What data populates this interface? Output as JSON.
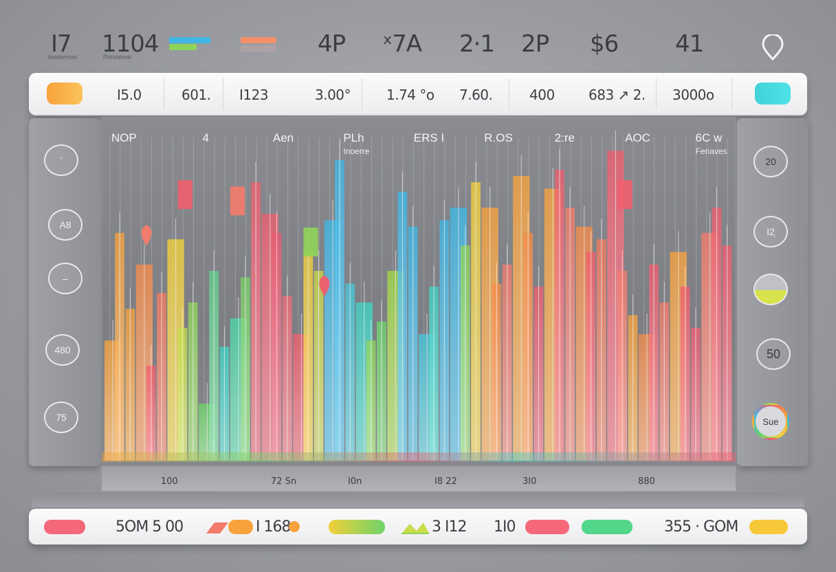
{
  "top_stats": [
    {
      "value": "I7",
      "sub": "Iooolvrnon"
    },
    {
      "value": "1104",
      "sub": "Porvomne"
    },
    {
      "value": "4P"
    },
    {
      "value": "ˣ7A"
    },
    {
      "value": "2·1"
    },
    {
      "value": "2P"
    },
    {
      "value": "$6"
    },
    {
      "value": "41"
    }
  ],
  "header_values": [
    "I5.0",
    "601.",
    "I123",
    "3.00°",
    "1.74 °o",
    "7.60.",
    "400",
    "683 ↗ 2.",
    "3000o"
  ],
  "left_controls": [
    "’",
    "A8",
    "–",
    "480",
    "75"
  ],
  "right_controls": [
    "20",
    "I2̩",
    "",
    "50",
    "Sue"
  ],
  "axis_labels": [
    "100",
    "72 Sn",
    "I0n",
    "I8 22",
    "3I0",
    "880"
  ],
  "bottom_values": [
    "5OM 5 00",
    "I 168",
    "3 I12",
    "1I0",
    "355 · GOM"
  ],
  "colors": {
    "red": "#ef5e6e",
    "orange": "#f7a23c",
    "yellow": "#f2d03a",
    "green": "#6fd36a",
    "teal": "#3fd2c4",
    "blue": "#3fb7e6",
    "coral": "#f47b6b"
  },
  "chart_data": {
    "type": "bar",
    "column_labels": [
      {
        "label": "NOP"
      },
      {
        "label": "4"
      },
      {
        "label": "Aen"
      },
      {
        "label": "PLh",
        "sub": "Inoerre"
      },
      {
        "label": "ERS I"
      },
      {
        "label": "R.OS"
      },
      {
        "label": "2:re"
      },
      {
        "label": "AOC"
      },
      {
        "label": "6C w",
        "sub": "Fenaves"
      }
    ],
    "x_labels": [
      "100",
      "72 Sn",
      "I0n",
      "I8 22",
      "3I0",
      "880"
    ],
    "values": [
      0.38,
      0.72,
      0.48,
      0.62,
      0.3,
      0.53,
      0.7,
      0.42,
      0.5,
      0.18,
      0.6,
      0.36,
      0.45,
      0.58,
      0.88,
      0.78,
      0.72,
      0.52,
      0.4,
      0.66,
      0.6,
      0.76,
      0.95,
      0.56,
      0.5,
      0.38,
      0.44,
      0.6,
      0.85,
      0.74,
      0.4,
      0.55,
      0.76,
      0.8,
      0.68,
      0.88,
      0.8,
      0.56,
      0.62,
      0.9,
      0.72,
      0.55,
      0.86,
      0.92,
      0.8,
      0.74,
      0.66,
      0.7,
      0.98,
      0.6,
      0.46,
      0.4,
      0.62,
      0.5,
      0.66,
      0.55,
      0.42,
      0.72,
      0.8,
      0.68
    ],
    "colors": [
      "#f7a23c",
      "#f7a23c",
      "#f7a23c",
      "#f58c4a",
      "#ef5e6e",
      "#f27a5d",
      "#f2d03a",
      "#c3dc4a",
      "#8fd45a",
      "#6fd36a",
      "#5fd08c",
      "#3fd2c4",
      "#4bd6a7",
      "#7bd068",
      "#ef5e6e",
      "#ef5e6e",
      "#e85a72",
      "#ef6a78",
      "#ef5e6e",
      "#f2d03a",
      "#c9d64a",
      "#3fb7e6",
      "#3fb7e6",
      "#46c5d8",
      "#3fd2c4",
      "#8fd45a",
      "#6fd36a",
      "#a3d84a",
      "#3fb7e6",
      "#3fb7e6",
      "#46c5d8",
      "#3fd2c4",
      "#3fb7e6",
      "#3fb7e6",
      "#8fd45a",
      "#f2d03a",
      "#f7a23c",
      "#f58c4a",
      "#f47b6b",
      "#f7a23c",
      "#f58c4a",
      "#ef5e6e",
      "#f7a23c",
      "#ef5e6e",
      "#f47b6b",
      "#f58c4a",
      "#ef5e6e",
      "#f27a5d",
      "#ef5e6e",
      "#f47b6b",
      "#f7a23c",
      "#f58c4a",
      "#ef5e6e",
      "#f47b6b",
      "#f7a23c",
      "#ef5e6e",
      "#ef5e6e",
      "#f47b6b",
      "#ef5e6e",
      "#ef5e6e"
    ],
    "markers": [
      {
        "index": 3,
        "value": 0.68,
        "color": "#f47b6b"
      },
      {
        "index": 20,
        "value": 0.52,
        "color": "#ef5e6e"
      }
    ],
    "peaks": [
      {
        "index": 7,
        "value": 0.8,
        "color": "#ef5e6e"
      },
      {
        "index": 12,
        "value": 0.78,
        "color": "#f47b6b"
      },
      {
        "index": 19,
        "value": 0.65,
        "color": "#8fd45a"
      },
      {
        "index": 49,
        "value": 0.8,
        "color": "#ef5e6e"
      }
    ]
  }
}
